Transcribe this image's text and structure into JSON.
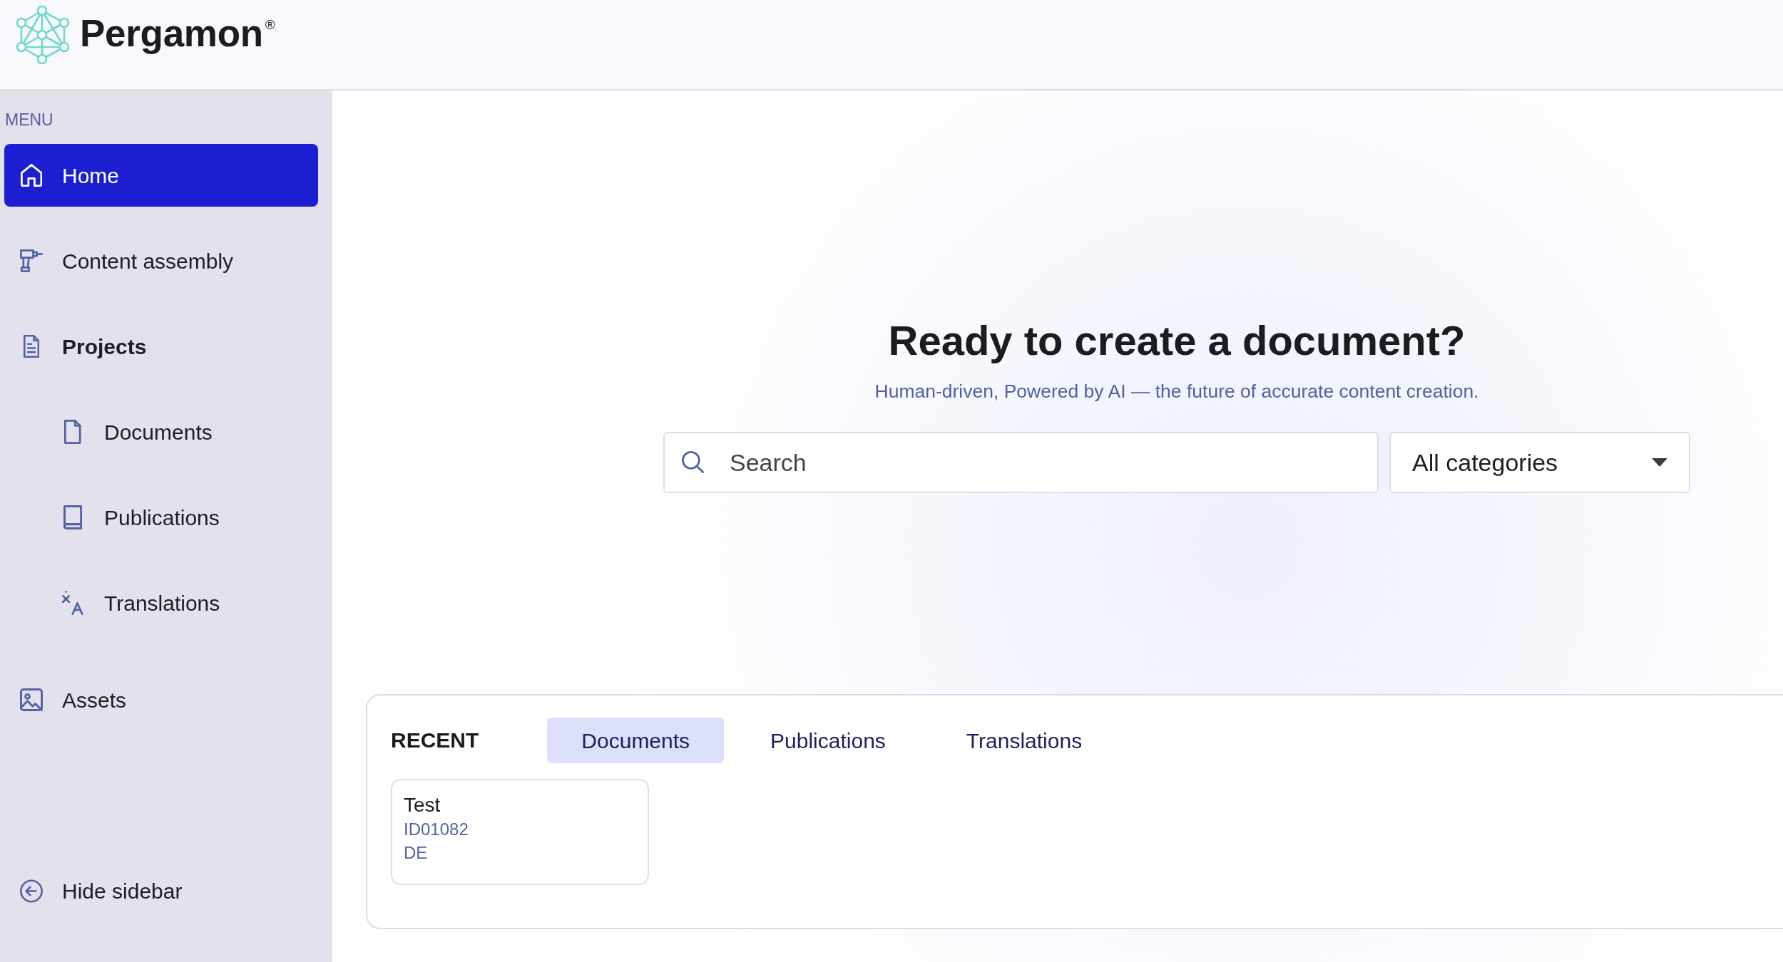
{
  "header": {
    "logo": "Pergamon$^{®}$"
  },
  "sidebar": {
    "menu_label": "MENU",
    "items": [
      {
        "label": "Home",
        "selected": true
      },
      {
        "label": "Content assembly",
        "selected": false
      },
      {
        "label": "Projects",
        "selected": false,
        "expanded": true,
        "children": [
          {
            "label": "Documents",
            "selected": false
          },
          {
            "label": "Publications",
            "selected": false
          },
          {
            "label": "Translations",
            "selected": false
          }
        ]
      },
      {
        "label": "Assets",
        "selected": false
      }
    ],
    "hide_button": "Hide sidebar"
  },
  "main": {
    "heading": "Ready to create a document?",
    "subtitle": "Human-driven, Powered by AI — the future of accurate content creation.",
    "search": {
      "placeholder": "Search"
    },
    "category_select": {
      "value": "All categories"
    },
    "recent": {
      "title": "RECENT",
      "tabs": [
        {
          "label": "Documents",
          "selected": true
        },
        {
          "label": "Publications",
          "selected": false
        },
        {
          "label": "Translations",
          "selected": false
        }
      ],
      "items": [
        {
          "title": "Test",
          "id": "ID01082",
          "language": "DE"
        }
      ]
    }
  }
}
